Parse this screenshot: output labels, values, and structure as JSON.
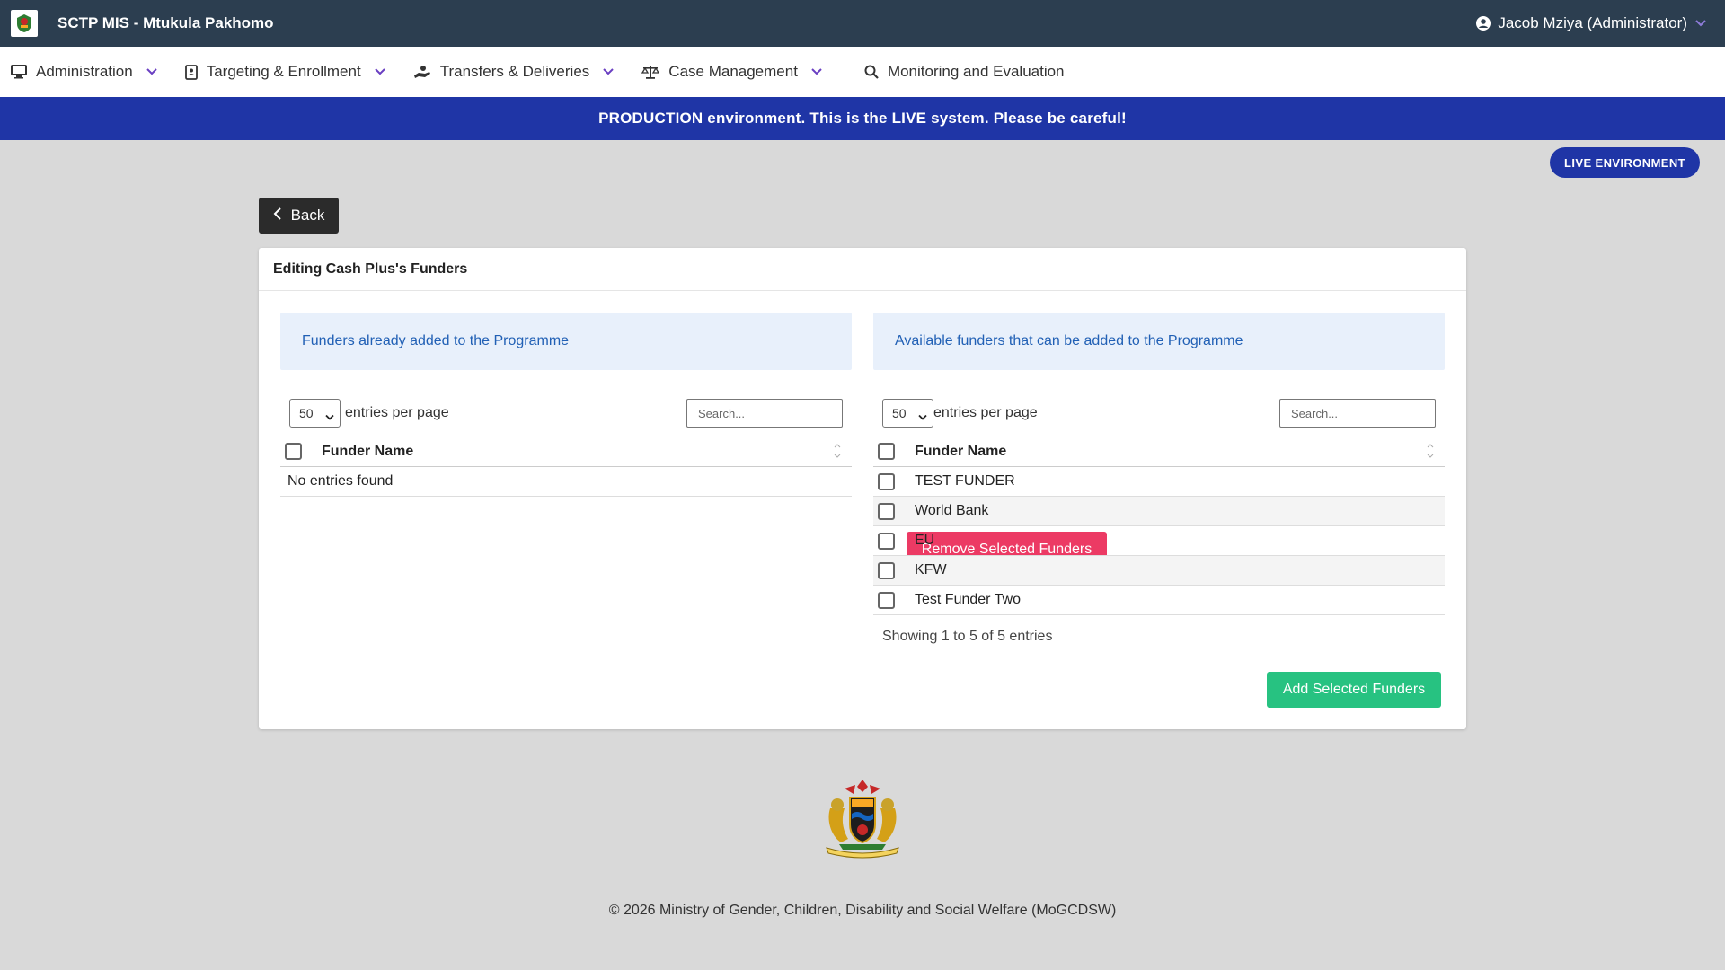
{
  "app": {
    "title": "SCTP MIS - Mtukula Pakhomo",
    "user": "Jacob Mziya (Administrator)"
  },
  "nav": {
    "items": [
      {
        "label": "Administration",
        "icon": "monitor-icon"
      },
      {
        "label": "Targeting & Enrollment",
        "icon": "address-book-icon"
      },
      {
        "label": "Transfers & Deliveries",
        "icon": "hand-holding-icon"
      },
      {
        "label": "Case Management",
        "icon": "scale-icon"
      },
      {
        "label": "Monitoring and Evaluation",
        "icon": "search-icon"
      }
    ]
  },
  "banner": "PRODUCTION environment. This is the LIVE system. Please be careful!",
  "live_badge": "LIVE ENVIRONMENT",
  "back_label": "Back",
  "card": {
    "title": "Editing Cash Plus's Funders"
  },
  "left": {
    "info": "Funders already added to the Programme",
    "page_size": "50",
    "entries_label": "entries per page",
    "search_placeholder": "Search...",
    "column": "Funder Name",
    "empty": "No entries found",
    "button": "Remove Selected Funders"
  },
  "right": {
    "info": "Available funders that can be added to the Programme",
    "page_size": "50",
    "entries_label": "entries per page",
    "search_placeholder": "Search...",
    "column": "Funder Name",
    "rows": [
      "TEST FUNDER",
      "World Bank",
      "EU",
      "KFW",
      "Test Funder Two"
    ],
    "showing": "Showing 1 to 5 of 5 entries",
    "button": "Add Selected Funders"
  },
  "footer": "© 2026 Ministry of Gender, Children, Disability and Social Welfare (MoGCDSW)",
  "colors": {
    "topbar": "#2c3e50",
    "banner": "#1f35a6",
    "remove": "#ec3a64",
    "add": "#27c281",
    "accent_chevron": "#6a3fc2"
  }
}
